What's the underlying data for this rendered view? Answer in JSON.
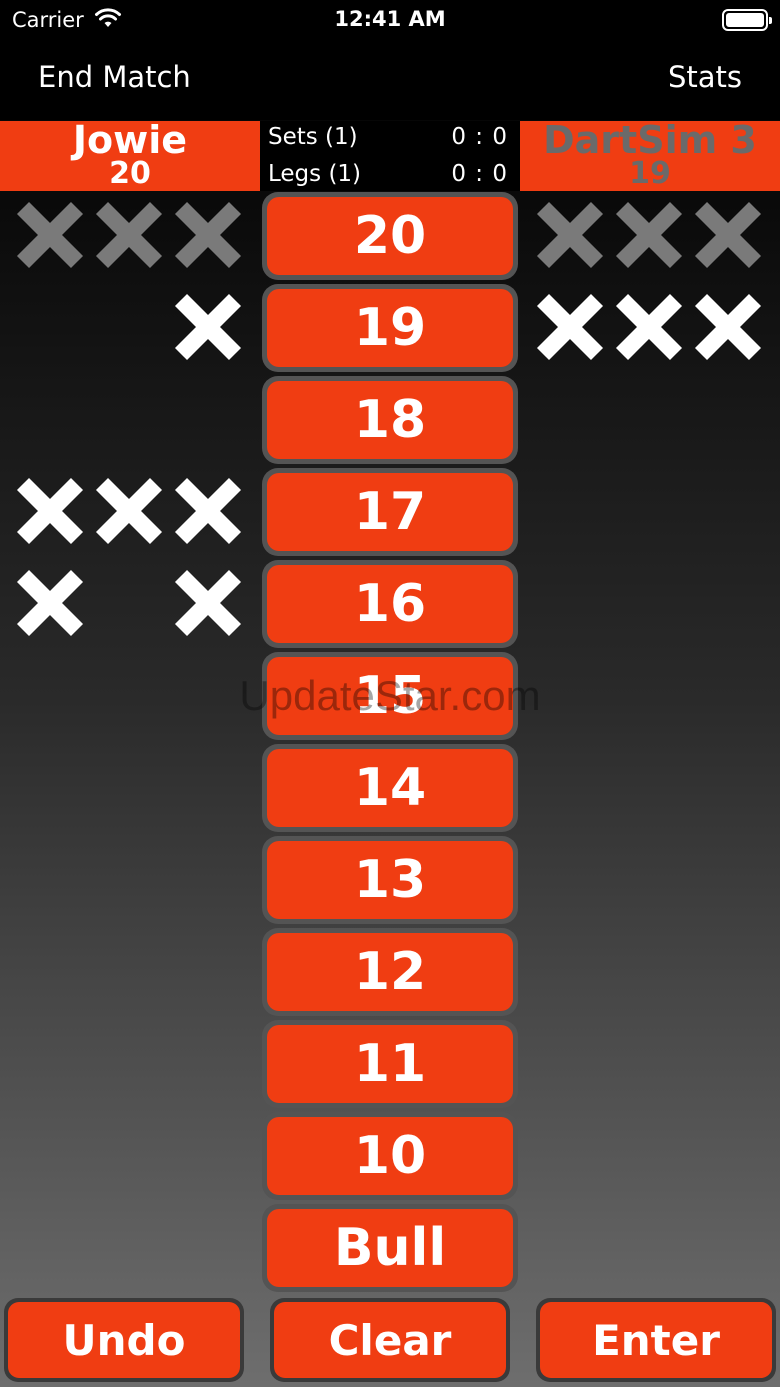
{
  "status_bar": {
    "carrier": "Carrier",
    "time": "12:41 AM"
  },
  "nav": {
    "end_match": "End Match",
    "stats": "Stats"
  },
  "players": {
    "left": {
      "name": "Jowie",
      "score": "20"
    },
    "right": {
      "name": "DartSim 3",
      "score": "19"
    }
  },
  "match_info": {
    "sets_label": "Sets (1)",
    "sets_value": "0 : 0",
    "legs_label": "Legs (1)",
    "legs_value": "0 : 0"
  },
  "targets": [
    "20",
    "19",
    "18",
    "17",
    "16",
    "15",
    "14",
    "13",
    "12",
    "11",
    "10",
    "Bull"
  ],
  "marks": {
    "left": [
      [
        "closed",
        "closed",
        "closed"
      ],
      [
        "none",
        "none",
        "open"
      ],
      [
        "none",
        "none",
        "none"
      ],
      [
        "open",
        "open",
        "open"
      ],
      [
        "open",
        "none",
        "open"
      ]
    ],
    "right": [
      [
        "closed",
        "closed",
        "closed"
      ],
      [
        "open",
        "open",
        "open"
      ]
    ]
  },
  "colors": {
    "accent": "#f03d12",
    "closed_mark": "#7a7a7a",
    "open_mark": "#ffffff"
  },
  "buttons": {
    "undo": "Undo",
    "clear": "Clear",
    "enter": "Enter"
  },
  "watermark": "UpdateStar.com"
}
